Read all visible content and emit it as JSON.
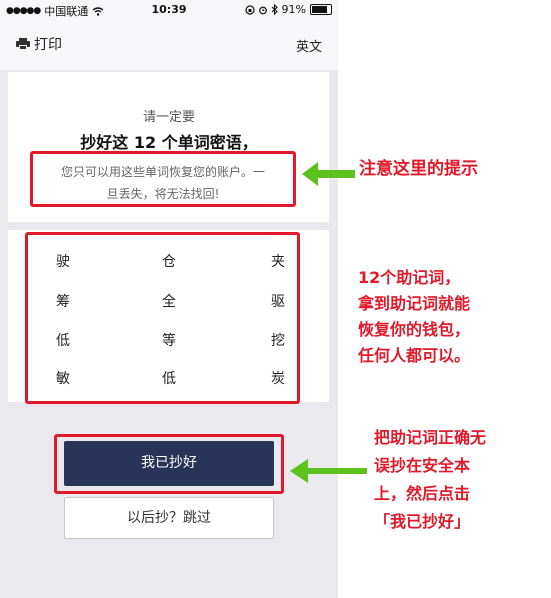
{
  "status_bar": {
    "carrier": "中国联通",
    "time": "10:39",
    "battery": "91%",
    "battery_level": 0.91
  },
  "nav": {
    "print_label": "打印",
    "lang_label": "英文"
  },
  "content": {
    "subtitle": "请一定要",
    "headline": "抄好这 12 个单词密语，",
    "hint_line1": "您只可以用这些单词恢复您的账户。一",
    "hint_line2": "旦丢失，将无法找回!"
  },
  "words": [
    "驶",
    "仓",
    "夹",
    "筹",
    "全",
    "驱",
    "低",
    "等",
    "挖",
    "敏",
    "低",
    "炭"
  ],
  "buttons": {
    "done": "我已抄好",
    "skip": "以后抄？跳过"
  },
  "annotations": {
    "a1": [
      "注意这里的提示"
    ],
    "a2": [
      "12个助记词，",
      "拿到助记词就能",
      "恢复你的钱包，",
      "任何人都可以。"
    ],
    "a3": [
      "把助记词正确无",
      "误抄在安全本",
      "上，然后点击",
      "「我已抄好」"
    ]
  },
  "colors": {
    "highlight": "#e0192b",
    "arrow": "#5dc21e",
    "button_primary": "#283458"
  }
}
